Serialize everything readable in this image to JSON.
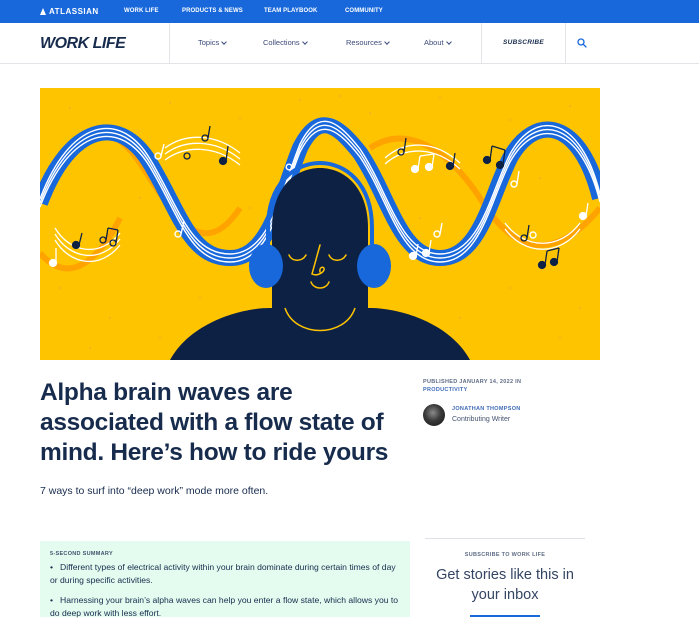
{
  "topbar": {
    "brand": "ATLASSIAN",
    "links": [
      "WORK LIFE",
      "PRODUCTS & NEWS",
      "TEAM PLAYBOOK",
      "COMMUNITY"
    ],
    "color": "#1868db"
  },
  "header": {
    "logo": "WORK LIFE",
    "nav": [
      {
        "label": "Topics",
        "icon": "chevron-down-icon"
      },
      {
        "label": "Collections",
        "icon": "chevron-down-icon"
      },
      {
        "label": "Resources",
        "icon": "chevron-down-icon"
      },
      {
        "label": "About",
        "icon": "chevron-down-icon"
      }
    ],
    "subscribe_label": "SUBSCRIBE",
    "search_icon": "search-icon"
  },
  "hero": {
    "description": "Illustration of a person with closed eyes wearing blue headphones, surrounded by blue sine waves and music notes on a yellow background",
    "colors": {
      "background": "#ffc400",
      "wave": "#1868db",
      "figure": "#0d2145",
      "accent": "#ffc400"
    }
  },
  "article": {
    "title": "Alpha brain waves are associated with a flow state of mind. Here’s how to ride yours",
    "title_lines": [
      "Alpha brain waves are",
      "associated with a flow state of",
      "mind. Here’s how to ride yours"
    ],
    "subtitle": "7 ways to surf into “deep work” mode more often.",
    "published_prefix": "PUBLISHED JANUARY 14, 2022 IN",
    "category": "PRODUCTIVITY",
    "author": {
      "name": "JONATHAN THOMPSON",
      "role": "Contributing Writer"
    }
  },
  "summary": {
    "label": "5-SECOND SUMMARY",
    "items": [
      "Different types of electrical activity within your brain dominate during certain times of day or during specific activities.",
      "Harnessing your brain’s alpha waves can help you enter a flow state, which allows you to do deep work with less effort."
    ]
  },
  "subscribe_widget": {
    "label": "SUBSCRIBE TO WORK LIFE",
    "heading": "Get stories like this in your inbox"
  }
}
